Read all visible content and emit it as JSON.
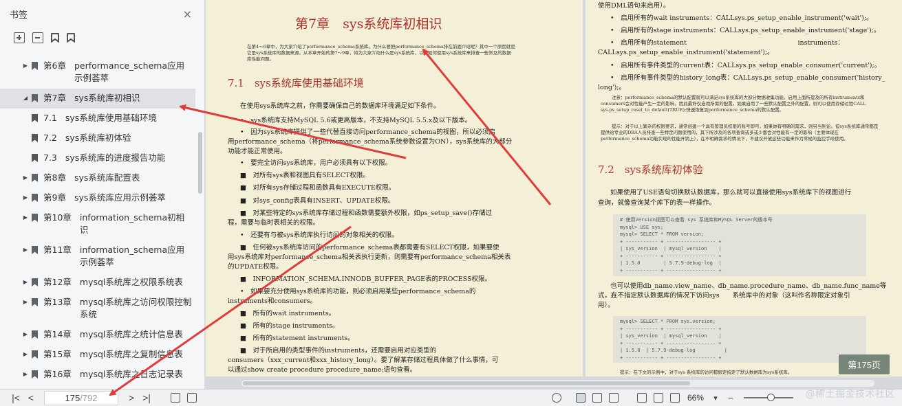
{
  "sidebar": {
    "title": "书签",
    "close": "×",
    "items": [
      {
        "num": "第6章",
        "label": "performance_schema应用示例荟萃",
        "arrow": "▶",
        "selected": false,
        "sub": false
      },
      {
        "num": "第7章",
        "label": "sys系统库初相识",
        "arrow": "◢",
        "selected": true,
        "sub": false
      },
      {
        "num": "7.1",
        "label": "sys系统库使用基础环境",
        "arrow": "",
        "selected": false,
        "sub": true
      },
      {
        "num": "7.2",
        "label": "sys系统库初体验",
        "arrow": "",
        "selected": false,
        "sub": true
      },
      {
        "num": "7.3",
        "label": "sys系统库的进度报告功能",
        "arrow": "",
        "selected": false,
        "sub": true
      },
      {
        "num": "第8章",
        "label": "sys系统库配置表",
        "arrow": "▶",
        "selected": false,
        "sub": false
      },
      {
        "num": "第9章",
        "label": "sys系统库应用示例荟萃",
        "arrow": "▶",
        "selected": false,
        "sub": false
      },
      {
        "num": "第10章",
        "label": "information_schema初相识",
        "arrow": "▶",
        "selected": false,
        "sub": false
      },
      {
        "num": "第11章",
        "label": "information_schema应用示例荟萃",
        "arrow": "▶",
        "selected": false,
        "sub": false
      },
      {
        "num": "第12章",
        "label": "mysql系统库之权限系统表",
        "arrow": "▶",
        "selected": false,
        "sub": false
      },
      {
        "num": "第13章",
        "label": "mysql系统库之访问权限控制系统",
        "arrow": "▶",
        "selected": false,
        "sub": false
      },
      {
        "num": "第14章",
        "label": "mysql系统库之统计信息表",
        "arrow": "▶",
        "selected": false,
        "sub": false
      },
      {
        "num": "第15章",
        "label": "mysql系统库之复制信息表",
        "arrow": "▶",
        "selected": false,
        "sub": false
      },
      {
        "num": "第16章",
        "label": "mysql系统库之日志记录表",
        "arrow": "▶",
        "selected": false,
        "sub": false
      },
      {
        "num": "第17章",
        "label": "mysql系统库应用示例荟萃",
        "arrow": "▶",
        "selected": false,
        "sub": false
      }
    ]
  },
  "page_left": {
    "chapter_title": "第7章　sys系统库初相识",
    "intro": "在第4～6章中，为大家介绍了performance_schema系统库。为什么要把performance_schema排在前面介绍呢？其中一个原因就是它是sys系统库的数据来源。从本章开始的第7～9章，将为大家介绍什么是sys系统库，以及如何使用sys系统库来排查一些常见的数据库性能问题。",
    "sec_title": "7.1　sys系统库使用基础环境",
    "lines": [
      "在使用sys系统库之前，你需要确保自己的数据库环境满足如下条件。",
      "•　sys系统库支持MySQL 5.6或更高版本，不支持MySQL 5.5.x及以下版本。",
      "•　因为sys系统库提供了一些代替直接访问performance_schema的视图，所以必须启",
      "用performance_schema（将performance_schema系统参数设置为ON），sys系统库的大部分",
      "功能才能正常使用。",
      "•　要完全访问sys系统库，用户必须具有以下权限。",
      "■　对所有sys表和视图具有SELECT权限。",
      "■　对所有sys存储过程和函数具有EXECUTE权限。",
      "■　对sys_config表具有INSERT、UPDATE权限。",
      "■　对某些特定的sys系统库存储过程和函数需要额外权限，如ps_setup_save()存储过",
      "程，需要与临时表相关的权限。",
      "•　还要有与被sys系统库执行访问的对象相关的权限。",
      "■　任何被sys系统库访问的performance_schema表都需要有SELECT权限，如果要使",
      "用sys系统库对performance_schema相关表执行更新，则需要有performance_schema相关表",
      "的UPDATE权限。",
      "■　INFORMATION_SCHEMA.INNODB_BUFFER_PAGE表的PROCESS权限。",
      "•　如果要充分使用sys系统库的功能，则必须启用某些performance_schema的",
      "instruments和consumers。",
      "■　所有的wait instruments。",
      "■　所有的stage instruments。",
      "■　所有的statement instruments。",
      "■　对于所启用的类型事件的instruments，还需要启用对应类型的",
      "consumers（xxx_current和xxx_history_long）。要了解某存储过程具体做了什么事情，可",
      "以通过show create procedure procedure_name;语句查看。"
    ]
  },
  "page_right": {
    "lines_top": [
      "使用DML语句来启用）。",
      "•　启用所有的wait instruments：CALLsys.ps_setup_enable_instrument('wait');。",
      "•　启用所有的stage instruments：CALLsys.ps_setup_enable_instrument('stage');。",
      "•　启用所有的statement　　　　　　　　　　　　　　　　　instruments：",
      "CALLsys.ps_setup_enable_instrument('statement');。",
      "•　启用所有事件类型的current表：CALLsys.ps_setup_enable_consumer('current');。",
      "•　启用所有事件类型的history_long表：CALLsys.ps_setup_enable_consumer('history_",
      "long');。"
    ],
    "note1": "注意：performance_schema的默认配置就可以满足sys系统库的大部分数据收集功能。启用上面所提及的所有instruments和consumers会对性能产生一定的影响，因此最好仅启用所需的配置。如果启用了一些默认配置之外的配置，则可以使用存储过程CALL sys.ps_setup_reset_to_default(TRUE);快速恢复到performance_schema的默认配置。",
    "note2": "提示：对于以上繁杂的权限要求，通常创建一个具有管理员权限的账号即可，如果你有明确的需求，则另当别论。但sys系统库通常都是提供给专业的DBA人员排查一些特定问题使用的，其下所涉及的各项查询或多或少都会对性能有一定的影响（主要体现在performance_schema功能实现的性能开销上），在不明确需求的情况下，不建议开放这些功能来作为常规的监控手段使用。",
    "sec_title": "7.2　sys系统库初体验",
    "para1a": "如果使用了USE语句切换默认数据库，那么就可以直接使用sys系统库下的视图进行",
    "para1b": "查询，就像查询某个库下的表一样操作。",
    "code1": "# 使用version视图可以查看 sys 系统库和MySQL Server的版本号\nmysql> USE sys;\nmysql> SELECT * FROM version;\n+ ----------- + ----------------- +\n| sys_version  | mysql_version    |\n+ ----------- + ----------------- +\n| 1.5.0        | 5.7.9-debug-log  |\n+ ----------- + ----------------- +",
    "para2a": "也可以使用db_name.view_name、db_name.procedure_name、db_name.func_name等方",
    "para2b": "式，在不指定默认数据库的情况下访问sys　　系统库中的对象（这叫作名称限定对象引",
    "para2c": "用）。",
    "code2": "mysql> SELECT * FROM sys.version;\n+ ----------- + ----------------- +\n| sys_version  | mysql_version    |\n+ ----------- + ----------------- +\n| 1.5.0  | 5.7.9-debug-log          |\n+ ----------- + ----------------- +",
    "tip": "提示：在下文的示例中，对于sys 系统库的访问都假定指定了默认数据库为sys系统库。"
  },
  "page_badge": "第175页",
  "bottom": {
    "current_page": "175",
    "total_pages": "/792",
    "zoom": "66%",
    "nav_first": "|<",
    "nav_prev": "<",
    "nav_next": ">",
    "nav_last": ">|"
  },
  "watermark": "@稀土掘金技术社区",
  "colors": {
    "accent_red": "#b0302b",
    "page_bg": "#f4f0d7",
    "arrow_red": "#e23b3b"
  }
}
